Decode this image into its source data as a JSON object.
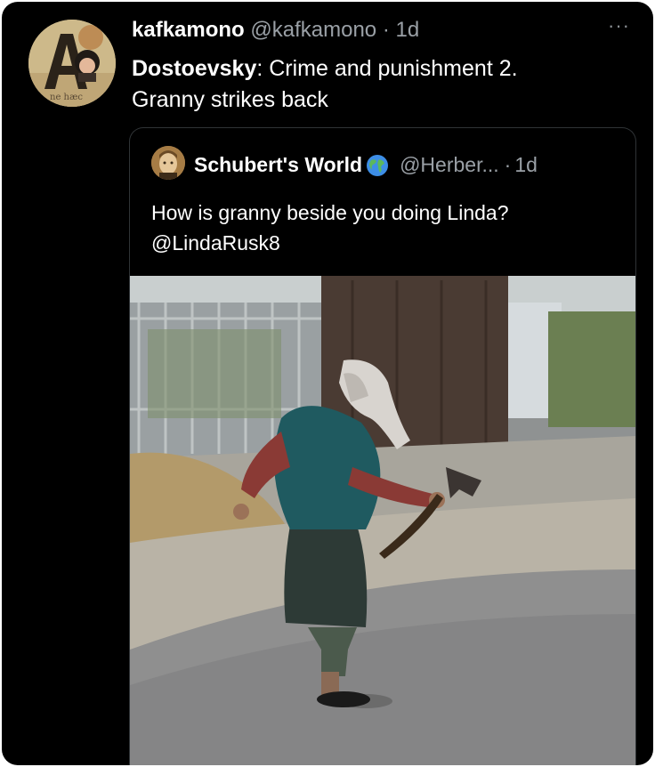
{
  "tweet": {
    "display_name": "kafkamono",
    "handle": "@kafkamono",
    "separator": "·",
    "time": "1d",
    "more_label": "···",
    "text_bold": "Dostoevsky",
    "text_rest": ": Crime and punishment 2.",
    "text_line2": "Granny strikes back"
  },
  "quoted": {
    "display_name": "Schubert's World",
    "handle": "@Herber...",
    "separator": "·",
    "time": "1d",
    "text_line1": "How is granny beside you doing Linda?",
    "text_line2": "@LindaRusk8"
  },
  "icons": {
    "avatar": "profile-avatar-book-cover",
    "quoted_avatar": "profile-avatar-portrait",
    "globe": "globe-emoji-icon",
    "more": "more-options-icon"
  },
  "colors": {
    "background": "#000000",
    "text": "#ffffff",
    "muted": "#9aa0a6",
    "border": "#2f3336"
  }
}
